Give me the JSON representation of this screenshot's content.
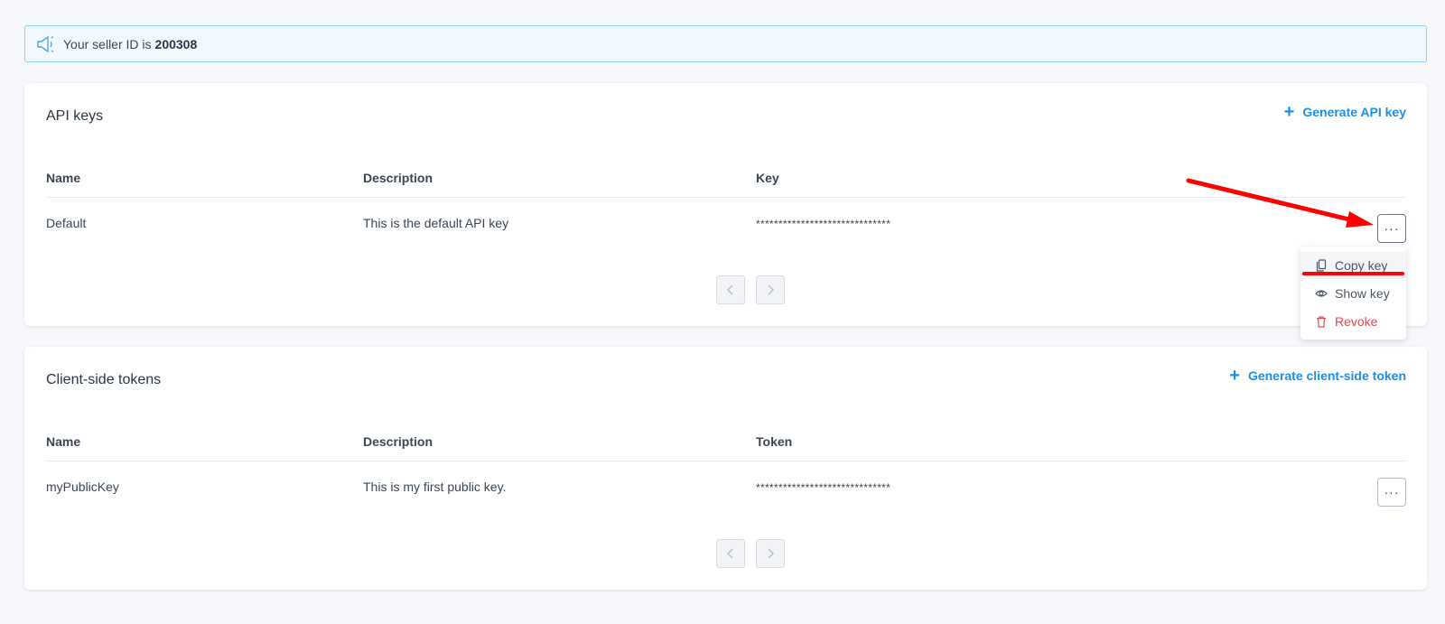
{
  "banner": {
    "prefix": "Your seller ID is",
    "seller_id": "200308",
    "icon": "megaphone-icon"
  },
  "api_keys": {
    "title": "API keys",
    "generate_label": "Generate API key",
    "columns": [
      "Name",
      "Description",
      "Key"
    ],
    "rows": [
      {
        "name": "Default",
        "description": "This is the default API key",
        "key": "******************************"
      }
    ]
  },
  "client_tokens": {
    "title": "Client-side tokens",
    "generate_label": "Generate client-side token",
    "columns": [
      "Name",
      "Description",
      "Token"
    ],
    "rows": [
      {
        "name": "myPublicKey",
        "description": "This is my first public key.",
        "token": "******************************"
      }
    ]
  },
  "row_menu": {
    "items": [
      {
        "label": "Copy key",
        "icon": "copy-icon"
      },
      {
        "label": "Show key",
        "icon": "eye-icon"
      },
      {
        "label": "Revoke",
        "icon": "trash-icon"
      }
    ]
  },
  "ellipsis_label": "···",
  "colors": {
    "accent": "#1f8ee3",
    "danger": "#e04b57",
    "annotation": "#ff0000",
    "banner_bg": "#f1f9ff",
    "banner_border": "#8fcdf2"
  }
}
